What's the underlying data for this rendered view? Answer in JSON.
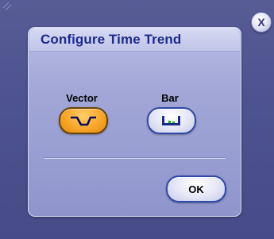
{
  "dialog": {
    "title": "Configure Time Trend",
    "close_label": "X",
    "options": [
      {
        "label": "Vector",
        "icon": "vector-trend-icon",
        "selected": true
      },
      {
        "label": "Bar",
        "icon": "bar-trend-icon",
        "selected": false
      }
    ],
    "ok_label": "OK"
  },
  "colors": {
    "background": "#4a4f86",
    "dialog_panel": "#a3a8d8",
    "title_text": "#1c2a8c",
    "selected_button": "#f7a62a",
    "button_border": "#2f49a8",
    "trace_green": "#1aa81a"
  }
}
